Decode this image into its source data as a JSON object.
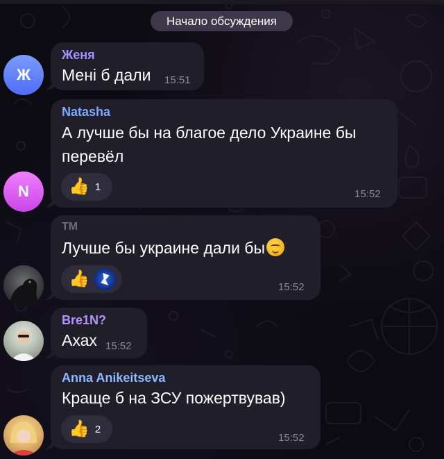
{
  "chat": {
    "service_header": "Начало обсуждения"
  },
  "messages": [
    {
      "sender": "Женя",
      "sender_color": "#a990ff",
      "avatar_letter": "Ж",
      "text": "Мені б дали",
      "time": "15:51"
    },
    {
      "sender": "Natasha",
      "sender_color": "#7fa9ff",
      "avatar_letter": "N",
      "text_line1": "А лучше бы на благое дело Украине бы",
      "text_line2": "перевёл",
      "time": "15:52",
      "reaction": {
        "icon": "thumbs-up",
        "count": "1"
      }
    },
    {
      "sender": "TM",
      "sender_color": "#6f6d78",
      "text": "Лучше бы украине дали бы",
      "emoji": "smirking-face",
      "time": "15:52",
      "reaction": {
        "icon": "thumbs-up",
        "reactor": "user-avatar"
      }
    },
    {
      "sender": "Bre1N?",
      "sender_color": "#b892ff",
      "text": "Ахах",
      "time": "15:52"
    },
    {
      "sender": "Anna Anikeitseva",
      "sender_color": "#8fb8ff",
      "text": "Краще б на ЗСУ пожертвував)",
      "time": "15:52",
      "reaction": {
        "icon": "thumbs-up",
        "count": "2"
      }
    }
  ]
}
